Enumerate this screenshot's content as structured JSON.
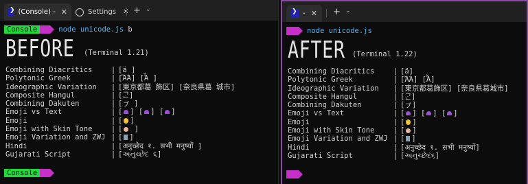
{
  "left": {
    "tab_title": "(Console) -",
    "tab_close": "✕",
    "settings_label": "Settings",
    "settings_close": "✕",
    "plus": "+",
    "chevron": "⌄",
    "prompt_label": "Console",
    "command": "node unicode.js",
    "command_arg": "b",
    "big_title": "BEFORE",
    "version": "(Terminal 1.21)",
    "rows": [
      {
        "label": "Combining Diacritics",
        "value": "[ä ]"
      },
      {
        "label": "Polytonic Greek",
        "value": "[ἍΆ] [Ἇ  ]"
      },
      {
        "label": "Ideographic Variation",
        "value": "[東京都葛 飾区] [奈良県葛 城市]"
      },
      {
        "label": "Composite Hangul",
        "value": "[ᄀᆞᆫ]"
      },
      {
        "label": "Combining Dakuten",
        "value": "[ㇷ゚ ]"
      },
      {
        "label": "Emoji vs Text",
        "value": "[  ] [  ] [  ]"
      },
      {
        "label": "Emoji",
        "value": "[  ]"
      },
      {
        "label": "Emoji with Skin Tone",
        "value": "[   ]"
      },
      {
        "label": "Emoji Variation and ZWJ",
        "value": "[  ]"
      },
      {
        "label": "Hindi",
        "value": "[अनुच्छेद १. सभी मनुष्यों  ]"
      },
      {
        "label": "Gujarati Script",
        "value": "[અનુચ્છેદ ૬]"
      }
    ],
    "bottom_prompt": "Console"
  },
  "right": {
    "tab_title": "-",
    "tab_close": "✕",
    "plus": "+",
    "chevron": "⌄",
    "command": "node unicode.js",
    "big_title": "AFTER",
    "version": "(Terminal 1.22)",
    "rows": [
      {
        "label": "Combining Diacritics",
        "value": "[ä]"
      },
      {
        "label": "Polytonic Greek",
        "value": "[ἍΆ] [Ἇ]"
      },
      {
        "label": "Ideographic Variation",
        "value": "[東京都葛飾区] [奈良県葛城市]"
      },
      {
        "label": "Composite Hangul",
        "value": "[ᄀᆞᆫ]"
      },
      {
        "label": "Combining Dakuten",
        "value": "[ㇷ゚]"
      },
      {
        "label": "Emoji vs Text",
        "value": "[  ] [  ] [  ]"
      },
      {
        "label": "Emoji",
        "value": "[  ]"
      },
      {
        "label": "Emoji with Skin Tone",
        "value": "[  ]"
      },
      {
        "label": "Emoji Variation and ZWJ",
        "value": "[  ]"
      },
      {
        "label": "Hindi",
        "value": "[अनुच्छेद १. सभी मनुष्यों]"
      },
      {
        "label": "Gujarati Script",
        "value": "[અનુચ્છેદ૬]"
      }
    ]
  },
  "icons": {
    "powershell": "powershell-icon",
    "settings": "gear-icon",
    "close": "close-icon",
    "plus": "plus-icon",
    "chevron": "chevron-down-icon"
  },
  "colors": {
    "prompt_green": "#1cdc3a",
    "prompt_magenta": "#c72fc9",
    "command_blue": "#58b0e8",
    "focus_border": "#8c49a8"
  }
}
